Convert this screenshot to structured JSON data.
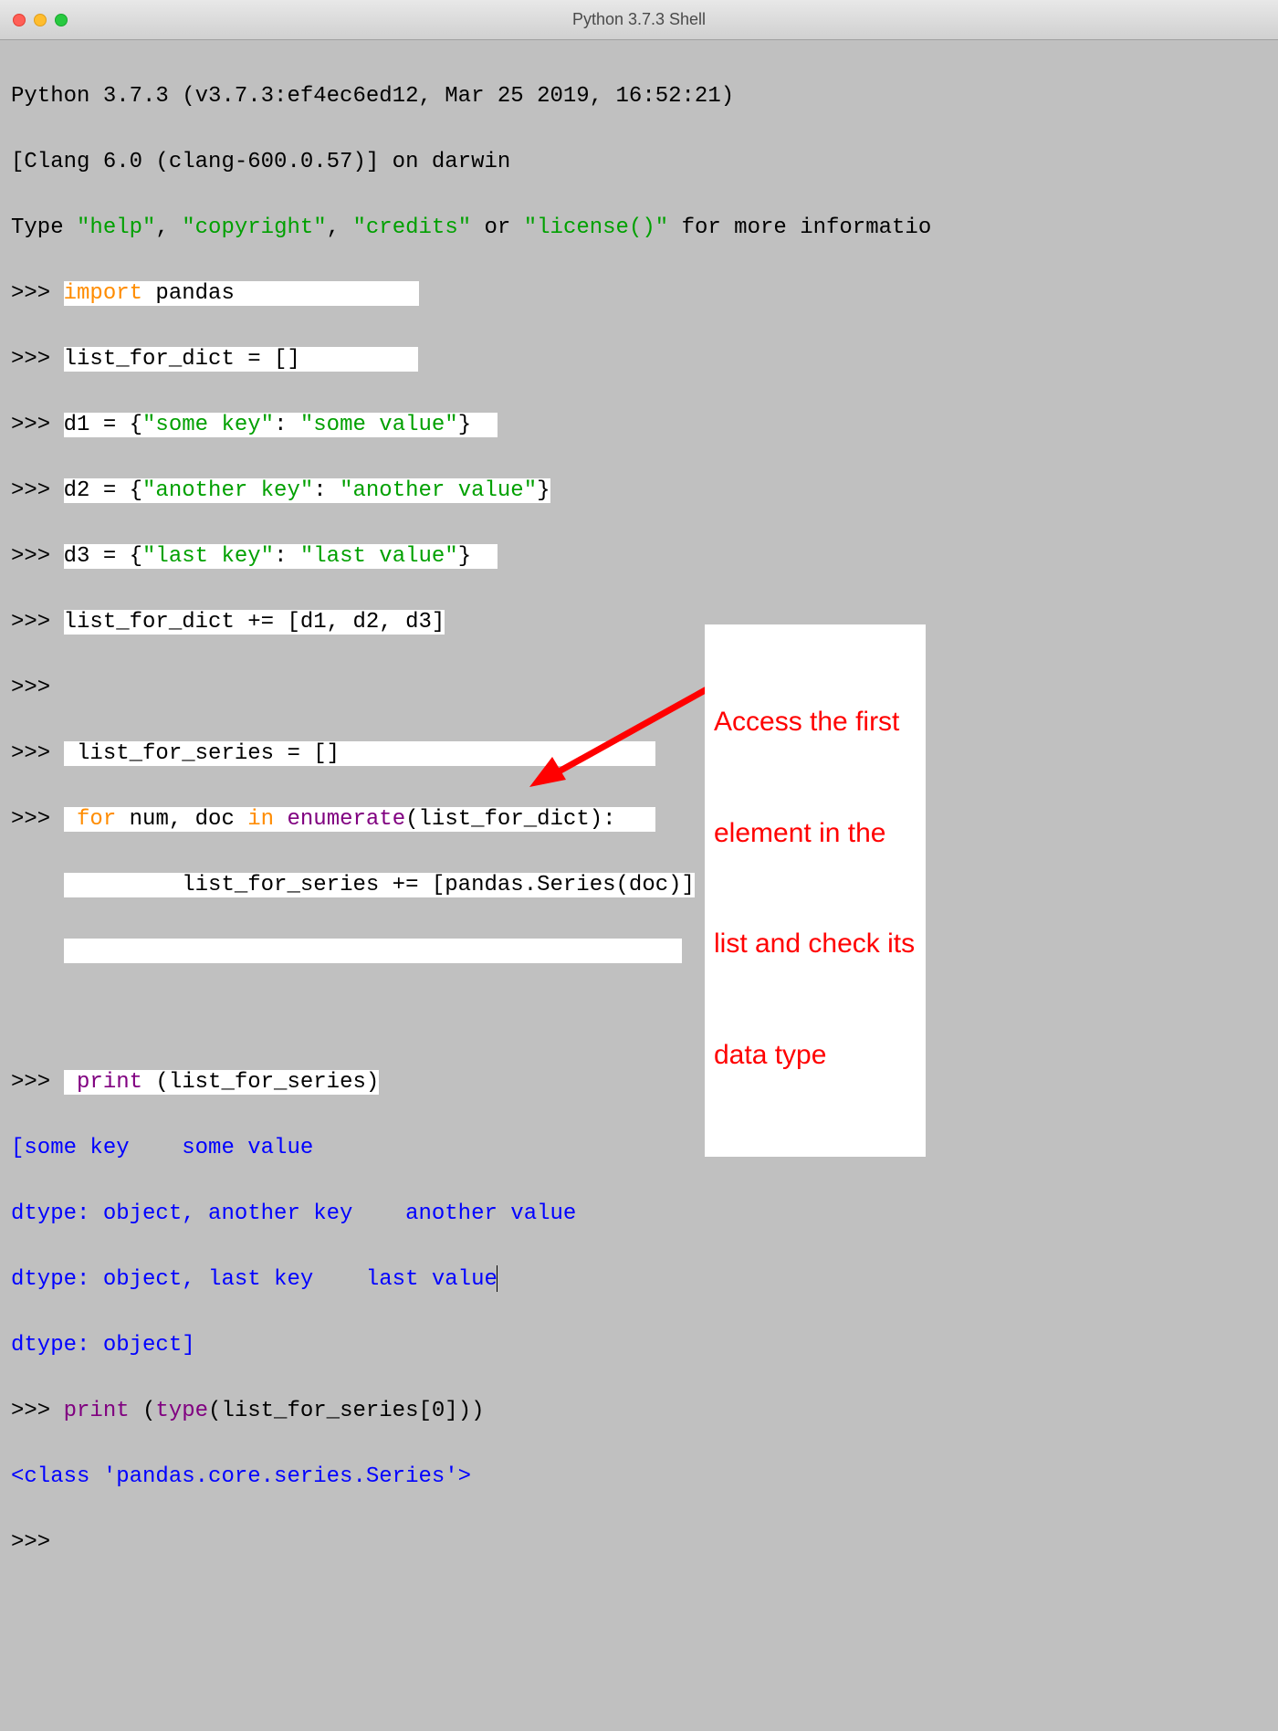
{
  "window": {
    "title": "Python 3.7.3 Shell"
  },
  "banner": {
    "line1": "Python 3.7.3 (v3.7.3:ef4ec6ed12, Mar 25 2019, 16:52:21) ",
    "line2": "[Clang 6.0 (clang-600.0.57)] on darwin",
    "line3_a": "Type ",
    "line3_b": "\"help\"",
    "line3_c": ", ",
    "line3_d": "\"copyright\"",
    "line3_e": ", ",
    "line3_f": "\"credits\"",
    "line3_g": " or ",
    "line3_h": "\"license()\"",
    "line3_i": " for more informatio"
  },
  "prompt": ">>> ",
  "cont": "",
  "code": {
    "import_kw": "import",
    "import_rest": " pandas",
    "l2": "list_for_dict = []",
    "d1_a": "d1 = {",
    "d1_k": "\"some key\"",
    "d1_c": ": ",
    "d1_v": "\"some value\"",
    "d1_z": "}",
    "d2_a": "d2 = {",
    "d2_k": "\"another key\"",
    "d2_c": ": ",
    "d2_v": "\"another value\"",
    "d2_z": "}",
    "d3_a": "d3 = {",
    "d3_k": "\"last key\"",
    "d3_c": ": ",
    "d3_v": "\"last value\"",
    "d3_z": "}",
    "l6": "list_for_dict += [d1, d2, d3]",
    "l7": "list_for_series = []",
    "for_kw": "for",
    "for_mid": " num, doc ",
    "in_kw": "in",
    "enum": "enumerate",
    "for_tail": "(list_for_dict):",
    "loop_body": "        list_for_series += [pandas.Series(doc)]",
    "print1_kw": "print",
    "print1_arg": " (list_for_series)",
    "print2_kw": "print",
    "print2_a": " (",
    "type_kw": "type",
    "print2_b": "(list_for_series[0]))"
  },
  "output": {
    "o1": "[some key    some value",
    "o2": "dtype: object, another key    another value",
    "o3": "dtype: object, last key    last value",
    "o4": "dtype: object]",
    "o5": "<class 'pandas.core.series.Series'>"
  },
  "annotation": {
    "line1": "Access the first",
    "line2": "element in the",
    "line3": "list and check its",
    "line4": "data type"
  }
}
